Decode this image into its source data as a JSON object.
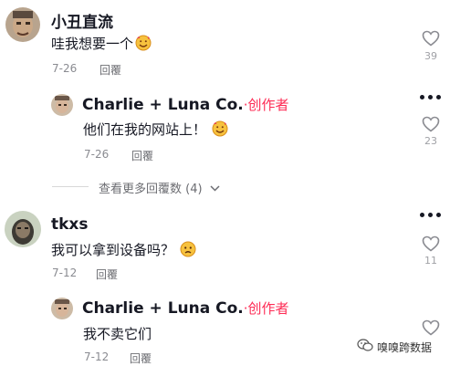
{
  "comments": [
    {
      "username": "小丑直流",
      "text": "哇我想要一个",
      "date": "7-26",
      "reply_label": "回覆",
      "likes": "39",
      "replies": [
        {
          "username": "Charlie + Luna Co.",
          "creator_tag": "·创作者",
          "text": "他们在我的网站上！",
          "date": "7-26",
          "reply_label": "回覆",
          "likes": "23"
        }
      ],
      "view_more": "查看更多回覆数 (4)"
    },
    {
      "username": "tkxs",
      "text": "我可以拿到设备吗？",
      "date": "7-12",
      "reply_label": "回覆",
      "likes": "11",
      "replies": [
        {
          "username": "Charlie + Luna Co.",
          "creator_tag": "·创作者",
          "text": "我不卖它们",
          "date": "7-12",
          "reply_label": "回覆",
          "likes": ""
        }
      ]
    }
  ],
  "watermark": {
    "text": "嗅嗅跨数据",
    "icon": "wechat-icon"
  },
  "colors": {
    "creator_accent": "#fe2c55",
    "muted_text": "#8a8b91"
  }
}
